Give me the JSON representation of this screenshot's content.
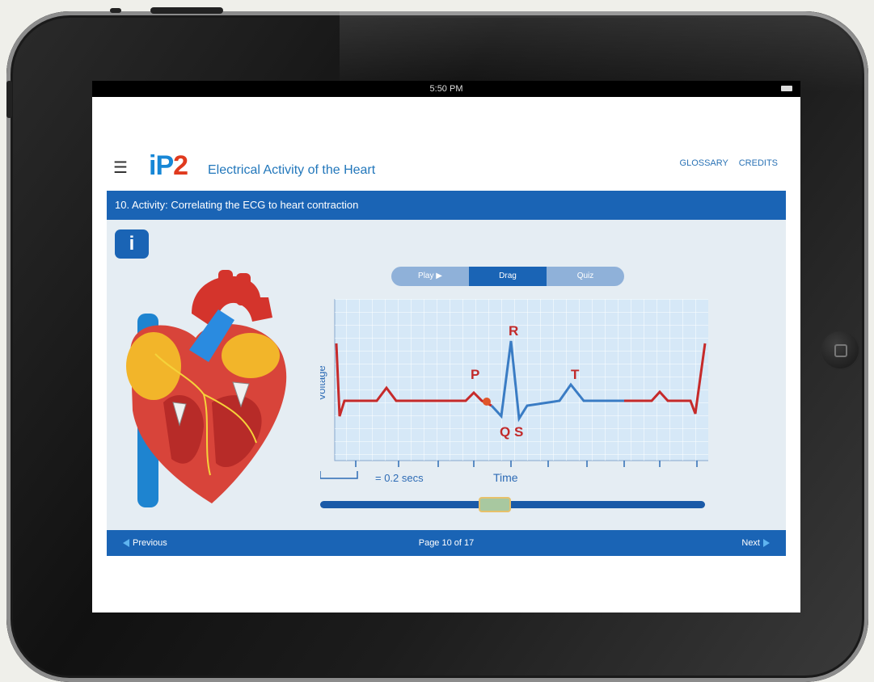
{
  "device": {
    "status_time": "5:50 PM"
  },
  "app": {
    "logo_a": "iP",
    "logo_b": "2",
    "title": "Electrical Activity of the Heart",
    "links": [
      "GLOSSARY",
      "CREDITS"
    ]
  },
  "section": {
    "title": "10. Activity: Correlating the ECG to heart contraction"
  },
  "info_button": "i",
  "tabs": [
    {
      "label": "Play ▶",
      "active": false
    },
    {
      "label": "Drag",
      "active": true
    },
    {
      "label": "Quiz",
      "active": false
    }
  ],
  "ecg": {
    "y_label": "Voltage",
    "x_label": "Time",
    "scale_label": "= 0.2 secs",
    "wave_labels": [
      "P",
      "R",
      "Q",
      "S",
      "T"
    ],
    "slider_value": 0.45,
    "colors": {
      "grid_bg": "#d6e8f7",
      "grid_line": "#ffffff",
      "trace_red": "#c62a2a",
      "trace_blue": "#3a7cc4",
      "label_red": "#c22a2a"
    }
  },
  "navigation": {
    "previous": "Previous",
    "page": "Page 10 of 17",
    "next": "Next"
  },
  "colors": {
    "brand_blue": "#1a64b5",
    "logo_red": "#e03a1e"
  }
}
